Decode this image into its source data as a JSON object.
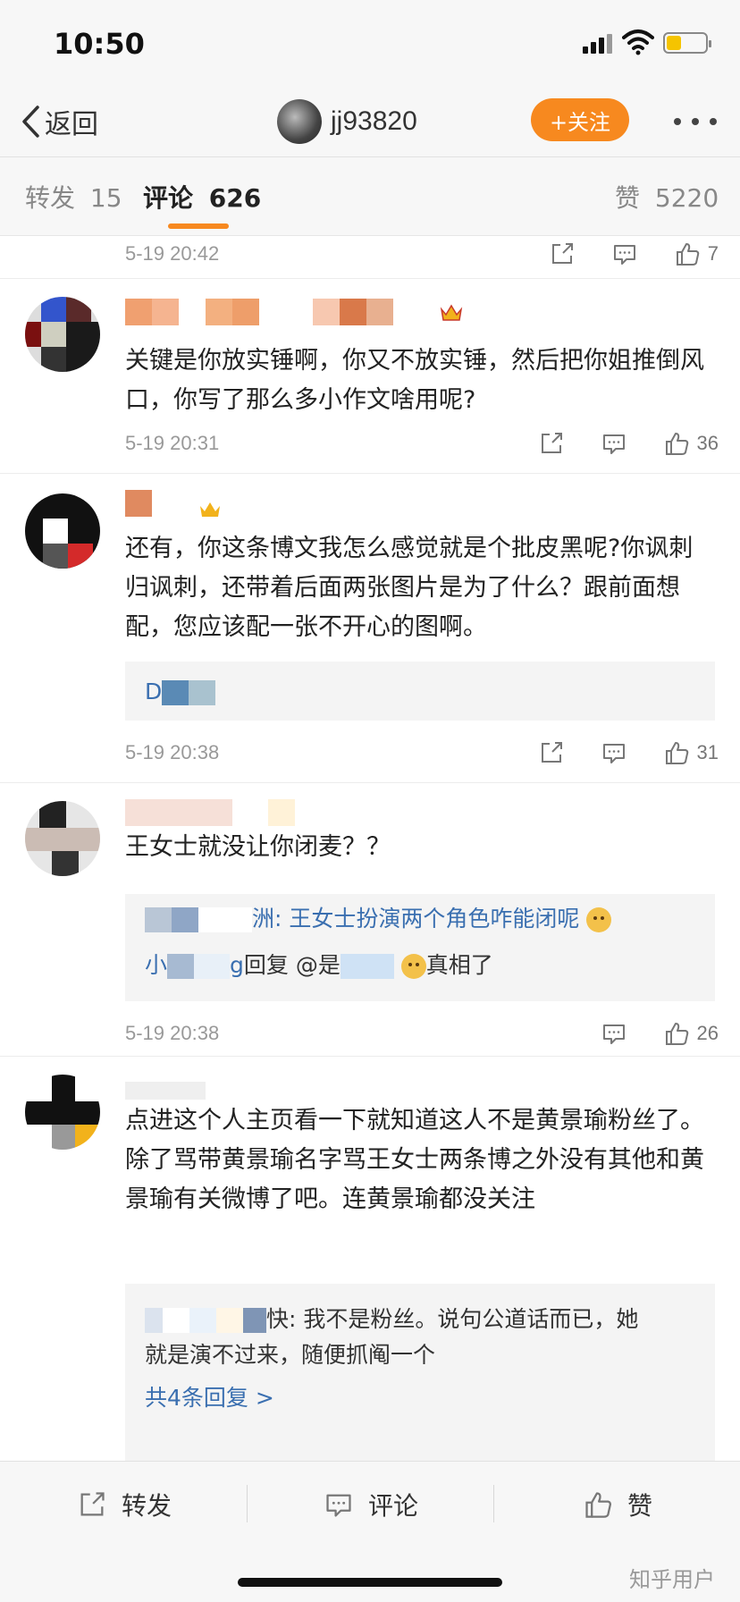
{
  "status_bar": {
    "time": "10:50"
  },
  "nav": {
    "back_label": "返回",
    "username": "jj93820",
    "follow_label": "+关注"
  },
  "tabs": [
    {
      "label": "转发",
      "count": "15"
    },
    {
      "label": "评论",
      "count": "626"
    },
    {
      "label": "赞",
      "count": "5220"
    }
  ],
  "comments": [
    {
      "date": "5-19 20:42",
      "likes": "7"
    },
    {
      "text": "关键是你放实锤啊，你又不放实锤，然后把你姐推倒风口，你写了那么多小作文啥用呢?",
      "date": "5-19 20:31",
      "likes": "36"
    },
    {
      "text": "还有，你这条博文我怎么感觉就是个批皮黑呢?你讽刺归讽刺，还带着后面两张图片是为了什么？跟前面想配，您应该配一张不开心的图啊。",
      "reply_name": "D",
      "date": "5-19 20:38",
      "likes": "31"
    },
    {
      "text": "王女士就没让你闭麦？？",
      "replies": [
        "洲: 王女士扮演两个角色咋能闭呢",
        "回复 @是",
        "真相了"
      ],
      "reply_prefix": "小",
      "reply_mid": "g",
      "date": "5-19 20:38",
      "likes": "26"
    },
    {
      "text": "点进这个人主页看一下就知道这人不是黄景瑜粉丝了。除了骂带黄景瑜名字骂王女士两条博之外没有其他和黄景瑜有关微博了吧。连黄景瑜都没关注",
      "replies": [
        "快: 我不是粉丝。说句公道话而已，她",
        "就是演不过来，随便抓阄一个"
      ],
      "more_replies": "共4条回复 >"
    }
  ],
  "bottom_bar": {
    "repost": "转发",
    "comment": "评论",
    "like": "赞"
  },
  "watermark": "知乎用户",
  "colors": {
    "accent": "#f7891f",
    "link": "#3a6fb0",
    "meta": "#999999"
  }
}
